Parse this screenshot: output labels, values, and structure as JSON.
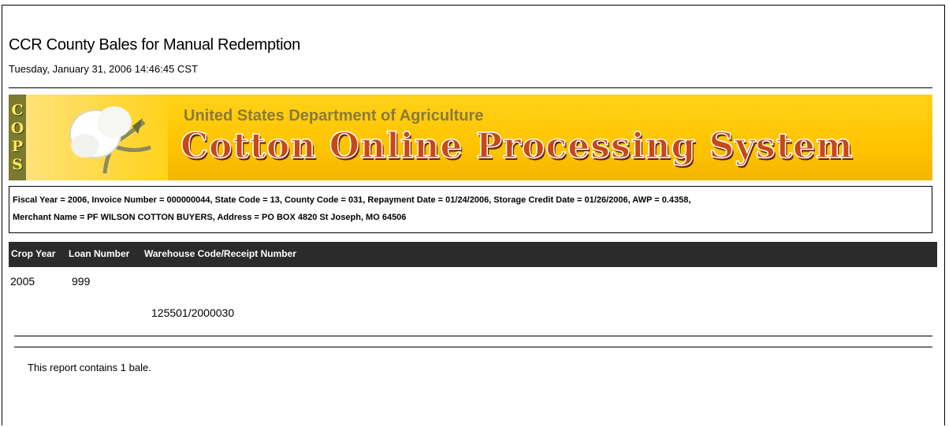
{
  "report": {
    "title": "CCR County Bales for Manual Redemption",
    "timestamp": "Tuesday, January 31, 2006 14:46:45 CST"
  },
  "banner": {
    "cops_letters": [
      "C",
      "O",
      "P",
      "S"
    ],
    "agency": "United States Department of Agriculture",
    "system_name": "Cotton Online Processing System",
    "colors": {
      "background": "#ffc400",
      "title": "#c84818",
      "agency": "#8a7a3a",
      "strip": "#7a7a30"
    },
    "logo_icon": "cotton-boll-icon"
  },
  "info": {
    "line1": "Fiscal Year = 2006, Invoice Number = 000000044, State Code = 13, County Code = 031, Repayment Date = 01/24/2006, Storage Credit Date = 01/26/2006, AWP = 0.4358,",
    "line2": "Merchant Name = PF WILSON COTTON BUYERS, Address = PO BOX 4820 St Joseph, MO 64506"
  },
  "table": {
    "headers": [
      "Crop Year",
      "Loan Number",
      "Warehouse Code/Receipt Number"
    ],
    "row": {
      "crop_year": "2005",
      "loan_number": "999",
      "warehouse_receipt": "125501/2000030"
    }
  },
  "summary": "This report contains 1 bale."
}
